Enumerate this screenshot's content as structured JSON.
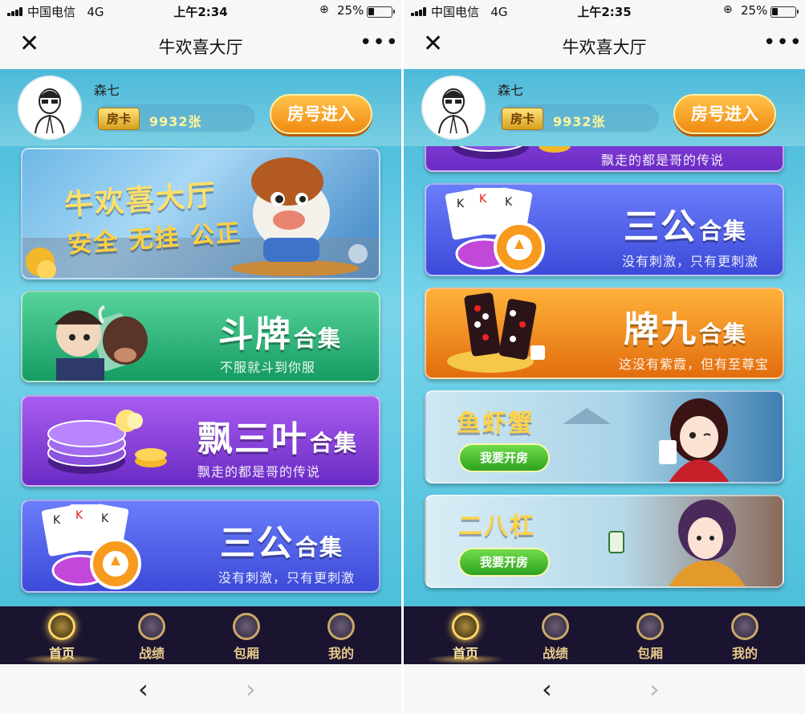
{
  "status_left": {
    "carrier": "中国电信",
    "network": "4G",
    "time": "上午2:34",
    "battery": "25%",
    "battery_level": 0.25
  },
  "status_right": {
    "carrier": "中国电信",
    "network": "4G",
    "time": "上午2:35",
    "battery": "25%",
    "battery_level": 0.25
  },
  "nav": {
    "title": "牛欢喜大厅",
    "close_icon": "close-icon",
    "more_icon": "more-icon"
  },
  "user": {
    "name": "森七",
    "card_label": "房卡",
    "card_count": "9932张"
  },
  "room_button": "房号进入",
  "banners": {
    "hero": {
      "line1": "牛欢喜大厅",
      "line2": "安全 无挂 公正"
    },
    "doupai": {
      "title": "斗牌",
      "suffix": "合集",
      "subtitle": "不服就斗到你服"
    },
    "piaosanye": {
      "title": "飘三叶",
      "suffix": "合集",
      "subtitle": "飘走的都是哥的传说"
    },
    "sangong": {
      "title": "三公",
      "suffix": "合集",
      "subtitle": "没有刺激，只有更刺激"
    },
    "paijiu": {
      "title": "牌九",
      "suffix": "合集",
      "subtitle": "这没有紫霞，但有至尊宝"
    },
    "yuxiaxie": {
      "title": "鱼虾蟹",
      "button": "我要开房"
    },
    "erbagang": {
      "title": "二八杠",
      "button": "我要开房"
    }
  },
  "tabs": [
    {
      "label": "首页",
      "icon": "spade-icon"
    },
    {
      "label": "战绩",
      "icon": "trophy-icon"
    },
    {
      "label": "包厢",
      "icon": "home-icon"
    },
    {
      "label": "我的",
      "icon": "user-icon"
    }
  ],
  "browser": {
    "back_icon": "chevron-left-icon",
    "forward_icon": "chevron-right-icon"
  }
}
